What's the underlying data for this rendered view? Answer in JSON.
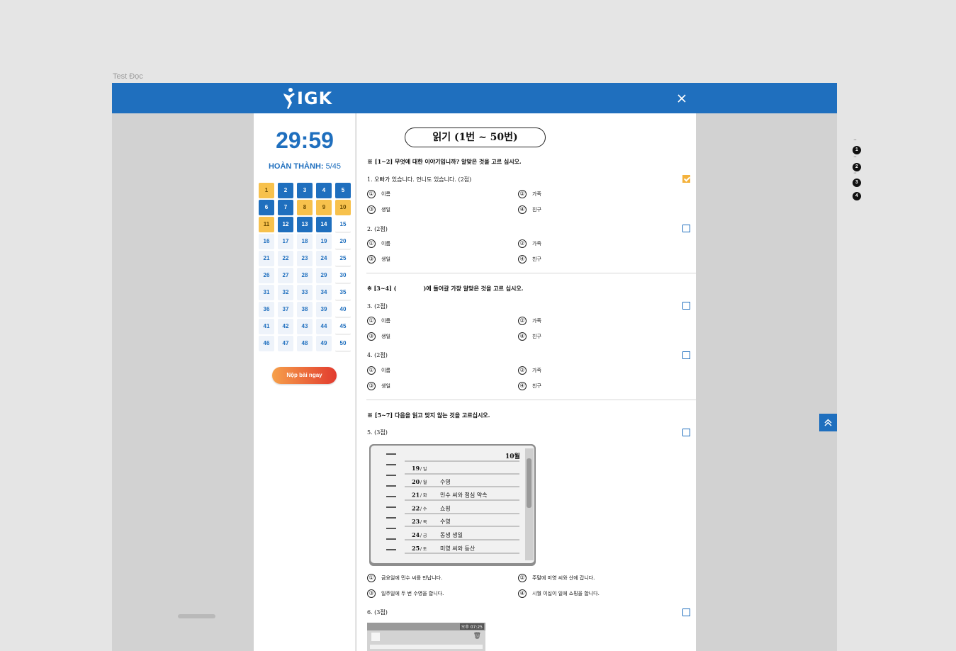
{
  "frame_label": "Test Đọc",
  "header": {
    "logo_text": "IGK",
    "brand_color": "#1f6fbe",
    "close_icon": "close-icon"
  },
  "sidebar": {
    "timer": "29:59",
    "progress_label": "HOÀN THÀNH:",
    "progress_value": "5/45",
    "questions": [
      {
        "n": "1",
        "state": "flagged"
      },
      {
        "n": "2",
        "state": "answered"
      },
      {
        "n": "3",
        "state": "answered"
      },
      {
        "n": "4",
        "state": "answered"
      },
      {
        "n": "5",
        "state": "answered"
      },
      {
        "n": "6",
        "state": "answered"
      },
      {
        "n": "7",
        "state": "answered"
      },
      {
        "n": "8",
        "state": "flagged"
      },
      {
        "n": "9",
        "state": "flagged"
      },
      {
        "n": "10",
        "state": "flagged"
      },
      {
        "n": "11",
        "state": "flagged"
      },
      {
        "n": "12",
        "state": "answered"
      },
      {
        "n": "13",
        "state": "answered"
      },
      {
        "n": "14",
        "state": "answered"
      },
      {
        "n": "15",
        "state": "plain"
      },
      {
        "n": "16",
        "state": "empty"
      },
      {
        "n": "17",
        "state": "empty"
      },
      {
        "n": "18",
        "state": "empty"
      },
      {
        "n": "19",
        "state": "empty"
      },
      {
        "n": "20",
        "state": "plain"
      },
      {
        "n": "21",
        "state": "empty"
      },
      {
        "n": "22",
        "state": "empty"
      },
      {
        "n": "23",
        "state": "empty"
      },
      {
        "n": "24",
        "state": "empty"
      },
      {
        "n": "25",
        "state": "plain"
      },
      {
        "n": "26",
        "state": "empty"
      },
      {
        "n": "27",
        "state": "empty"
      },
      {
        "n": "28",
        "state": "empty"
      },
      {
        "n": "29",
        "state": "empty"
      },
      {
        "n": "30",
        "state": "plain"
      },
      {
        "n": "31",
        "state": "empty"
      },
      {
        "n": "32",
        "state": "empty"
      },
      {
        "n": "33",
        "state": "empty"
      },
      {
        "n": "34",
        "state": "empty"
      },
      {
        "n": "35",
        "state": "plain"
      },
      {
        "n": "36",
        "state": "empty"
      },
      {
        "n": "37",
        "state": "empty"
      },
      {
        "n": "38",
        "state": "empty"
      },
      {
        "n": "39",
        "state": "empty"
      },
      {
        "n": "40",
        "state": "plain"
      },
      {
        "n": "41",
        "state": "empty"
      },
      {
        "n": "42",
        "state": "empty"
      },
      {
        "n": "43",
        "state": "empty"
      },
      {
        "n": "44",
        "state": "empty"
      },
      {
        "n": "45",
        "state": "plain"
      },
      {
        "n": "46",
        "state": "empty"
      },
      {
        "n": "47",
        "state": "empty"
      },
      {
        "n": "48",
        "state": "empty"
      },
      {
        "n": "49",
        "state": "empty"
      },
      {
        "n": "50",
        "state": "plain"
      }
    ],
    "submit_label": "Nộp bài ngay"
  },
  "content": {
    "section_title": "읽기 (1번 ~ 50번)",
    "instructions": [
      "※ [1~2] 무엇에 대한 이야기입니까? 알맞은 것을 고르 십시오.",
      "※ [3~4] (",
      ")에 들어갈 가장 알맞은 것을 고르 십시오.",
      "※ [5~7] 다음을 읽고 맞지 않는 것을 고르십시오."
    ],
    "questions": [
      {
        "title": "1. 오빠가 있습니다. 언니도 있습니다. (2점)",
        "checked": true,
        "options": [
          "이름",
          "가족",
          "생일",
          "친구"
        ]
      },
      {
        "title": "2. (2점)",
        "checked": false,
        "options": [
          "이름",
          "가족",
          "생일",
          "친구"
        ]
      },
      {
        "title": "3. (2점)",
        "checked": false,
        "options": [
          "이름",
          "가족",
          "생일",
          "친구"
        ]
      },
      {
        "title": "4. (2점)",
        "checked": false,
        "options": [
          "이름",
          "가족",
          "생일",
          "친구"
        ]
      },
      {
        "title": "5. (3점)",
        "checked": false,
        "options": [
          "금요일에 민수 씨를 만납니다.",
          "주말에 미영 씨와 산에 갑니다.",
          "일주일에 두 번 수영을 합니다.",
          "시월 이십이 일에 쇼핑을 합니다."
        ]
      },
      {
        "title": "6. (3점)",
        "checked": false,
        "options": []
      }
    ],
    "option_markers": [
      "①",
      "②",
      "③",
      "④"
    ],
    "diary": {
      "month": "10월",
      "rows": [
        {
          "date": "19",
          "day": "일",
          "text": ""
        },
        {
          "date": "20",
          "day": "월",
          "text": "수영"
        },
        {
          "date": "21",
          "day": "화",
          "text": "민수 씨와 점심 약속"
        },
        {
          "date": "22",
          "day": "수",
          "text": "쇼핑"
        },
        {
          "date": "23",
          "day": "목",
          "text": "수영"
        },
        {
          "date": "24",
          "day": "금",
          "text": "동생 생일"
        },
        {
          "date": "25",
          "day": "토",
          "text": "미영 씨와 등산"
        }
      ]
    },
    "phone": {
      "status_time": "오후 07:25"
    }
  },
  "pager": [
    "1",
    "2",
    "3",
    "4"
  ],
  "back_to_top_icon": "chevron-double-up-icon"
}
